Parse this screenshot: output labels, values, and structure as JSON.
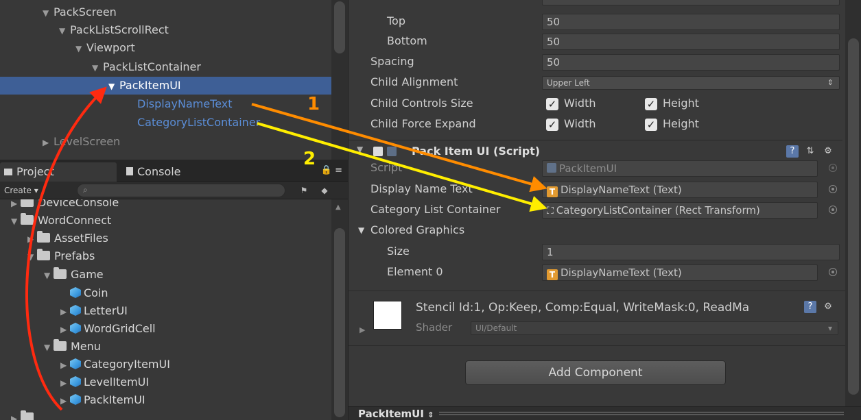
{
  "hierarchy": {
    "rows": [
      {
        "label": "PackScreen",
        "tri": "▼"
      },
      {
        "label": "PackListScrollRect",
        "tri": "▼"
      },
      {
        "label": "Viewport",
        "tri": "▼"
      },
      {
        "label": "PackListContainer",
        "tri": "▼"
      },
      {
        "label": "PackItemUI",
        "tri": "▼"
      },
      {
        "label": "DisplayNameText",
        "tri": ""
      },
      {
        "label": "CategoryListContainer",
        "tri": ""
      },
      {
        "label": "LevelScreen",
        "tri": "▶"
      }
    ]
  },
  "project": {
    "tabs": {
      "project": "Project",
      "console": "Console"
    },
    "create": "Create ▾",
    "search_placeholder": "",
    "tree": [
      {
        "label": "DeviceConsole",
        "tri": "▶",
        "icon": "folder"
      },
      {
        "label": "WordConnect",
        "tri": "▼",
        "icon": "folder"
      },
      {
        "label": "AssetFiles",
        "tri": "▶",
        "icon": "folder"
      },
      {
        "label": "Prefabs",
        "tri": "▼",
        "icon": "folder"
      },
      {
        "label": "Game",
        "tri": "▼",
        "icon": "folder"
      },
      {
        "label": "Coin",
        "tri": "",
        "icon": "prefab-cube"
      },
      {
        "label": "LetterUI",
        "tri": "▶",
        "icon": "prefab-cube"
      },
      {
        "label": "WordGridCell",
        "tri": "▶",
        "icon": "prefab-cube"
      },
      {
        "label": "Menu",
        "tri": "▼",
        "icon": "folder"
      },
      {
        "label": "CategoryItemUI",
        "tri": "▶",
        "icon": "prefab-cube"
      },
      {
        "label": "LevelItemUI",
        "tri": "▶",
        "icon": "prefab-cube"
      },
      {
        "label": "PackItemUI",
        "tri": "▶",
        "icon": "prefab-cube"
      }
    ]
  },
  "inspector": {
    "padding": {
      "top_label": "Top",
      "top_value": "50",
      "bottom_label": "Bottom",
      "bottom_value": "50"
    },
    "spacing_label": "Spacing",
    "spacing_value": "50",
    "child_alignment_label": "Child Alignment",
    "child_alignment_value": "Upper Left",
    "child_controls_label": "Child Controls Size",
    "child_force_label": "Child Force Expand",
    "width_label": "Width",
    "height_label": "Height",
    "component_title": "Pack Item UI (Script)",
    "script_label": "Script",
    "script_value": "PackItemUI",
    "display_name_label": "Display Name Text",
    "display_name_value": "DisplayNameText (Text)",
    "category_list_label": "Category List Container",
    "category_list_value": "CategoryListContainer (Rect Transform)",
    "colored_graphics_label": "Colored Graphics",
    "size_label": "Size",
    "size_value": "1",
    "element0_label": "Element 0",
    "element0_value": "DisplayNameText (Text)",
    "material_stencil": "Stencil Id:1, Op:Keep, Comp:Equal, WriteMask:0, ReadMa",
    "shader_label": "Shader",
    "shader_value": "UI/Default",
    "add_component": "Add Component",
    "bottom_label": "PackItemUI"
  },
  "annotations": {
    "label_1": "1",
    "label_2": "2",
    "arrow_1_color": "#ff8c00",
    "arrow_2_color": "#ffee00",
    "curve_color": "#ff2a10"
  },
  "colors": {
    "selection": "#3e5f96",
    "link_text": "#5b8ed8",
    "panel_bg": "#383838"
  }
}
